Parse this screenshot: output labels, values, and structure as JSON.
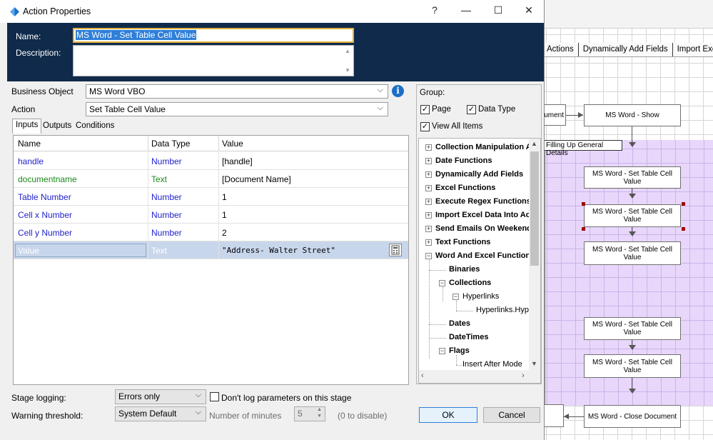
{
  "dialog": {
    "title": "Action Properties",
    "controls": {
      "help": "?",
      "minimize": "—",
      "maximize": "☐",
      "close": "✕"
    },
    "name_label": "Name:",
    "name_value": "MS Word - Set Table Cell Value",
    "description_label": "Description:",
    "business_object_label": "Business Object",
    "business_object_value": "MS Word VBO",
    "action_label": "Action",
    "action_value": "Set Table Cell Value",
    "tabs": [
      "Inputs",
      "Outputs",
      "Conditions"
    ],
    "grid": {
      "headers": [
        "Name",
        "Data Type",
        "Value"
      ],
      "rows": [
        {
          "name": "handle",
          "type": "Number",
          "value": "[handle]"
        },
        {
          "name": "documentname",
          "type": "Text",
          "value": "[Document Name]"
        },
        {
          "name": "Table Number",
          "type": "Number",
          "value": "1"
        },
        {
          "name": "Cell x Number",
          "type": "Number",
          "value": "1"
        },
        {
          "name": "Cell y Number",
          "type": "Number",
          "value": "2"
        },
        {
          "name": "Value",
          "type": "Text",
          "value": "\"Address- Walter Street\""
        }
      ]
    },
    "group": {
      "label": "Group:",
      "page_label": "Page",
      "page_checked": true,
      "datatype_label": "Data Type",
      "datatype_checked": true,
      "viewall_label": "View All Items",
      "viewall_checked": true,
      "tree": [
        "Collection Manipulation Ac",
        "Date Functions",
        "Dynamically Add Fields",
        "Excel Functions",
        "Execute Regex Functions",
        "Import Excel Data Into Acce",
        "Send Emails On Weekends",
        "Text Functions",
        "Word And Excel Functions",
        "Binaries",
        "Collections",
        "Hyperlinks",
        "Hyperlinks.Hype",
        "Dates",
        "DateTimes",
        "Flags",
        "Insert After Mode"
      ]
    },
    "stage_logging_label": "Stage logging:",
    "stage_logging_value": "Errors only",
    "dont_log_label": "Don't log parameters on this stage",
    "warning_label": "Warning threshold:",
    "warning_value": "System Default",
    "minutes_label": "Number of minutes",
    "minutes_value": "5",
    "disable_hint": "(0 to disable)",
    "ok_label": "OK",
    "cancel_label": "Cancel"
  },
  "canvas": {
    "tabs": [
      "Actions",
      "Dynamically Add Fields",
      "Import Excel"
    ],
    "block_label": "Filling Up General Details",
    "stages": [
      "ument",
      "MS Word - Show",
      "MS Word - Set Table Cell Value",
      "MS Word - Set Table Cell Value",
      "MS Word - Set Table Cell Value",
      "MS Word - Set Table Cell Value",
      "MS Word - Set Table Cell Value",
      "MS Word - Close Document"
    ]
  }
}
